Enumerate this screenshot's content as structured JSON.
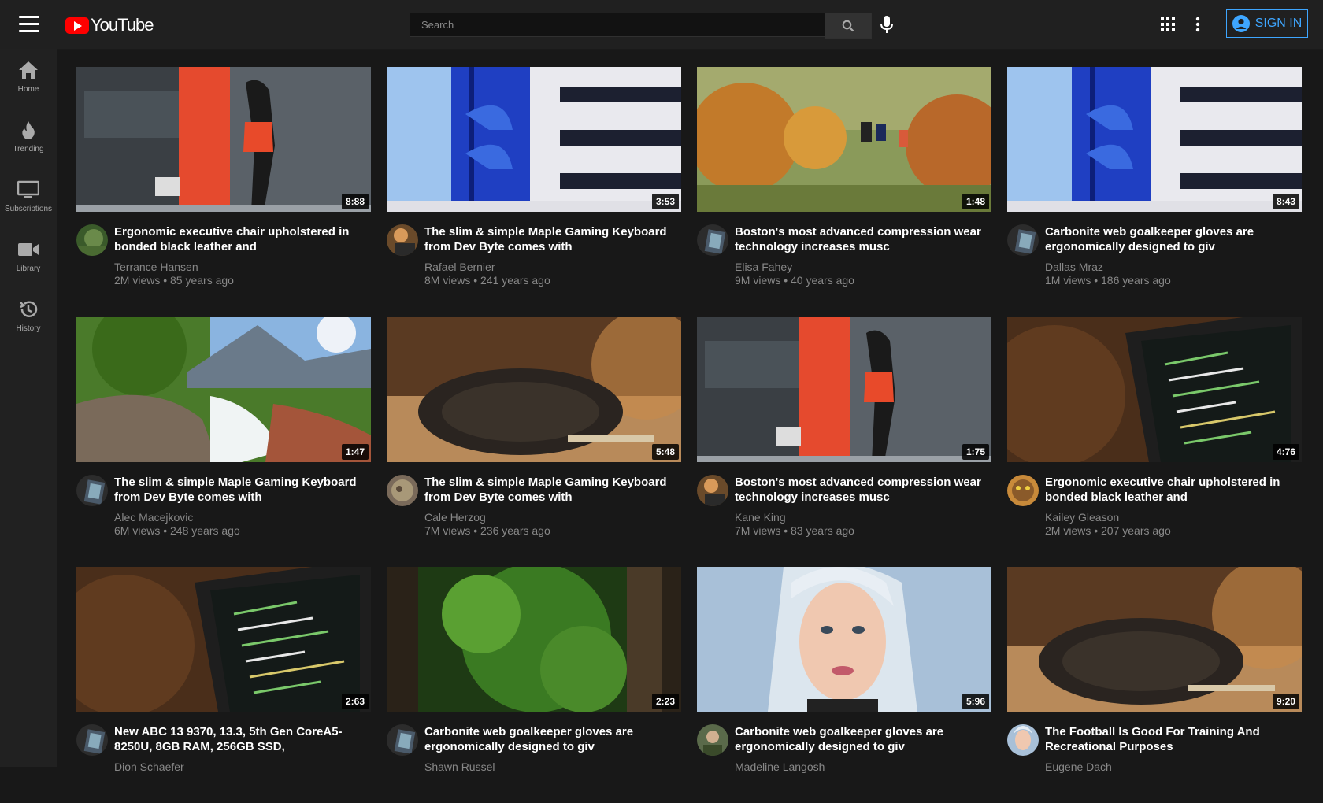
{
  "header": {
    "logo_text": "YouTube",
    "search_placeholder": "Search",
    "signin_label": "SIGN IN"
  },
  "sidebar": {
    "items": [
      {
        "label": "Home",
        "icon": "home-icon"
      },
      {
        "label": "Trending",
        "icon": "flame-icon"
      },
      {
        "label": "Subscriptions",
        "icon": "subscriptions-icon"
      },
      {
        "label": "Library",
        "icon": "library-icon"
      },
      {
        "label": "History",
        "icon": "history-icon"
      }
    ]
  },
  "videos": [
    {
      "title": "Ergonomic executive chair upholstered in bonded black leather and",
      "channel": "Terrance Hansen",
      "meta": "2M views • 85 years ago",
      "duration": "8:88"
    },
    {
      "title": "The slim & simple Maple Gaming Keyboard from Dev Byte comes with",
      "channel": "Rafael Bernier",
      "meta": "8M views • 241 years ago",
      "duration": "3:53"
    },
    {
      "title": "Boston's most advanced compression wear technology increases musc",
      "channel": "Elisa Fahey",
      "meta": "9M views • 40 years ago",
      "duration": "1:48"
    },
    {
      "title": "Carbonite web goalkeeper gloves are ergonomically designed to giv",
      "channel": "Dallas Mraz",
      "meta": "1M views • 186 years ago",
      "duration": "8:43"
    },
    {
      "title": "The slim & simple Maple Gaming Keyboard from Dev Byte comes with",
      "channel": "Alec Macejkovic",
      "meta": "6M views • 248 years ago",
      "duration": "1:47"
    },
    {
      "title": "The slim & simple Maple Gaming Keyboard from Dev Byte comes with",
      "channel": "Cale Herzog",
      "meta": "7M views • 236 years ago",
      "duration": "5:48"
    },
    {
      "title": "Boston's most advanced compression wear technology increases musc",
      "channel": "Kane King",
      "meta": "7M views • 83 years ago",
      "duration": "1:75"
    },
    {
      "title": "Ergonomic executive chair upholstered in bonded black leather and",
      "channel": "Kailey Gleason",
      "meta": "2M views • 207 years ago",
      "duration": "4:76"
    },
    {
      "title": "New ABC 13 9370, 13.3, 5th Gen CoreA5-8250U, 8GB RAM, 256GB SSD,",
      "channel": "Dion Schaefer",
      "meta": "",
      "duration": "2:63"
    },
    {
      "title": "Carbonite web goalkeeper gloves are ergonomically designed to giv",
      "channel": "Shawn Russel",
      "meta": "",
      "duration": "2:23"
    },
    {
      "title": "Carbonite web goalkeeper gloves are ergonomically designed to giv",
      "channel": "Madeline Langosh",
      "meta": "",
      "duration": "5:96"
    },
    {
      "title": "The Football Is Good For Training And Recreational Purposes",
      "channel": "Eugene Dach",
      "meta": "",
      "duration": "9:20"
    }
  ]
}
